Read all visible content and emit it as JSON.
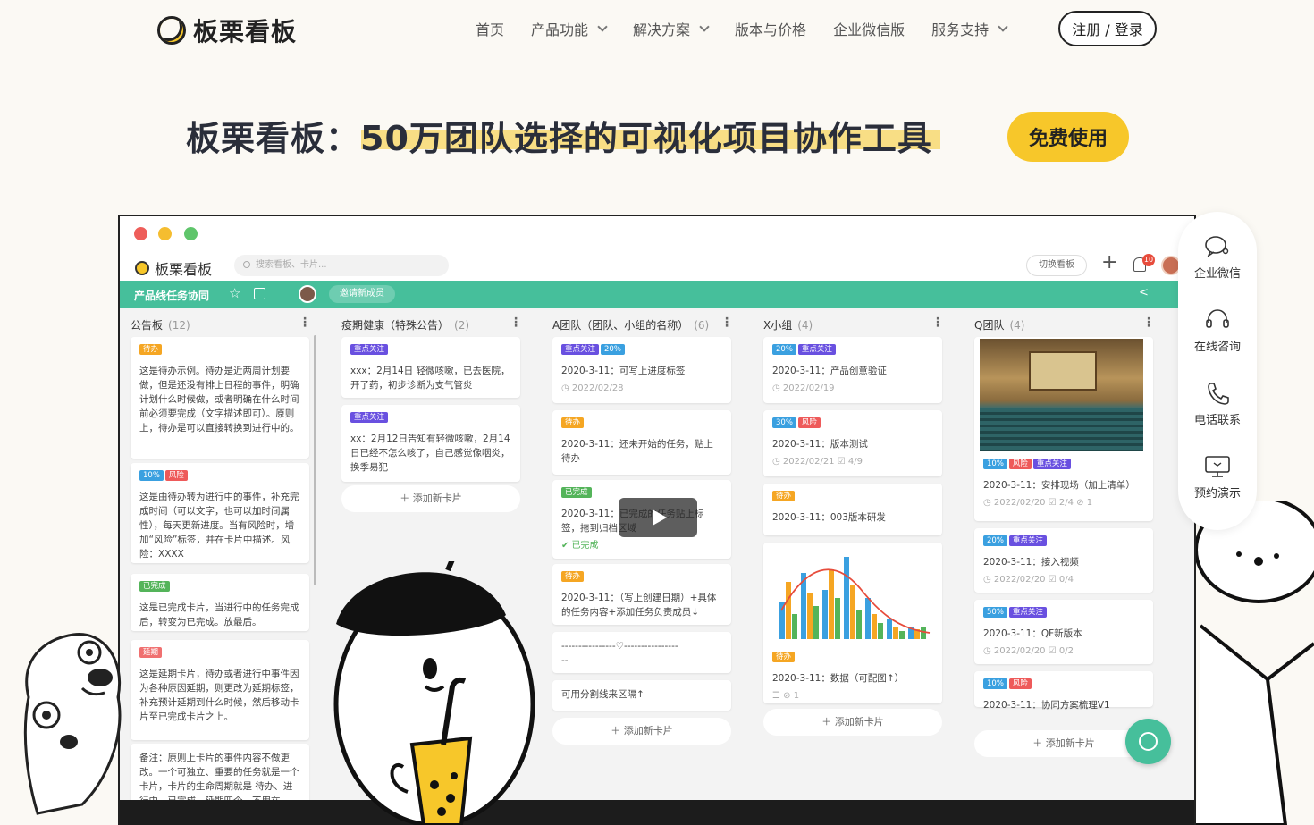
{
  "nav": {
    "logo_text": "板栗看板",
    "items": [
      {
        "label": "首页",
        "dropdown": false
      },
      {
        "label": "产品功能",
        "dropdown": true
      },
      {
        "label": "解决方案",
        "dropdown": true
      },
      {
        "label": "版本与价格",
        "dropdown": false
      },
      {
        "label": "企业微信版",
        "dropdown": false
      },
      {
        "label": "服务支持",
        "dropdown": true
      }
    ],
    "login_label": "注册 / 登录"
  },
  "hero": {
    "title": "板栗看板：50万团队选择的可视化项目协作工具",
    "cta_label": "免费使用"
  },
  "app": {
    "logo_text": "板栗看板",
    "search_placeholder": "搜索看板、卡片...",
    "switch_label": "切换看板",
    "notification_count": "10",
    "board_title": "产品线任务协同",
    "invite_label": "邀请新成员",
    "add_card_label": "＋ 添加新卡片"
  },
  "lists": [
    {
      "title": "公告板",
      "count": "(12)",
      "cards": [
        {
          "tags": [
            {
              "text": "待办",
              "type": "todo"
            }
          ],
          "text": "这是待办示例。待办是近两周计划要做，但是还没有排上日程的事件，明确计划什么时候做，或者明确在什么时间前必须要完成（文字描述即可）。原则上，待办是可以直接转换到进行中的。"
        },
        {
          "tags": [
            {
              "text": "10%",
              "type": "pct"
            },
            {
              "text": "风险",
              "type": "risk"
            }
          ],
          "text": "这是由待办转为进行中的事件，补充完成时间（可以文字，也可以加时间属性），每天更新进度。当有风险时，增加“风险”标签，并在卡片中描述。风险：XXXX"
        },
        {
          "tags": [
            {
              "text": "已完成",
              "type": "done"
            }
          ],
          "text": "这是已完成卡片，当进行中的任务完成后，转变为已完成。放最后。"
        },
        {
          "tags": [
            {
              "text": "延期",
              "type": "late"
            }
          ],
          "text": "这是延期卡片，待办或者进行中事件因为各种原因延期，则更改为延期标签，补充预计延期到什么时候，然后移动卡片至已完成卡片之上。"
        },
        {
          "tags": [],
          "text": "备注：原则上卡片的事件内容不做更改。一个可独立、重要的任务就是一个卡片，卡片的生命周期就是 待办、进行中、已完成、延期四个。不用在"
        }
      ]
    },
    {
      "title": "疫期健康（特殊公告）",
      "count": "(2)",
      "cards": [
        {
          "tags": [
            {
              "text": "重点关注",
              "type": "imp"
            }
          ],
          "text": "xxx：2月14日 轻微咳嗽，已去医院，开了药，初步诊断为支气管炎"
        },
        {
          "tags": [
            {
              "text": "重点关注",
              "type": "imp"
            }
          ],
          "text": "xx：2月12日告知有轻微咳嗽，2月14日已经不怎么咳了，自己感觉像咽炎，换季易犯"
        }
      ]
    },
    {
      "title": "A团队（团队、小组的名称）",
      "count": "(6)",
      "cards": [
        {
          "tags": [
            {
              "text": "重点关注",
              "type": "imp"
            },
            {
              "text": "20%",
              "type": "pct"
            }
          ],
          "text": "2020-3-11：可写上进度标签",
          "meta": "◷ 2022/02/28"
        },
        {
          "tags": [
            {
              "text": "待办",
              "type": "todo"
            }
          ],
          "text": "2020-3-11：还未开始的任务，贴上待办"
        },
        {
          "tags": [
            {
              "text": "已完成",
              "type": "done"
            }
          ],
          "text": "2020-3-11：已完成的任务贴上标签，拖到归档区域",
          "meta": "✔ 已完成"
        },
        {
          "tags": [
            {
              "text": "待办",
              "type": "todo"
            }
          ],
          "text": "2020-3-11：（写上创建日期）+具体的任务内容+添加任务负责成员↓"
        },
        {
          "tags": [],
          "text": "----------------♡----------------\n--"
        },
        {
          "tags": [],
          "text": "可用分割线来区隔↑"
        }
      ]
    },
    {
      "title": "X小组",
      "count": "(4)",
      "cards": [
        {
          "tags": [
            {
              "text": "20%",
              "type": "pct"
            },
            {
              "text": "重点关注",
              "type": "imp"
            }
          ],
          "text": "2020-3-11：产品创意验证",
          "meta": "◷ 2022/02/19"
        },
        {
          "tags": [
            {
              "text": "30%",
              "type": "pct"
            },
            {
              "text": "风险",
              "type": "risk"
            }
          ],
          "text": "2020-3-11：版本测试",
          "meta": "◷ 2022/02/21 ☑ 4/9"
        },
        {
          "tags": [
            {
              "text": "待办",
              "type": "todo"
            }
          ],
          "text": "2020-3-11：003版本研发"
        },
        {
          "tags": [
            {
              "text": "待办",
              "type": "todo"
            }
          ],
          "text": "2020-3-11：数据（可配图↑）",
          "meta": "☰ ⊘ 1"
        }
      ]
    },
    {
      "title": "Q团队",
      "count": "(4)",
      "cards": [
        {
          "tags": [
            {
              "text": "10%",
              "type": "pct"
            },
            {
              "text": "风险",
              "type": "risk"
            },
            {
              "text": "重点关注",
              "type": "imp"
            }
          ],
          "text": "2020-3-11：安排现场（加上清单）",
          "meta": "◷ 2022/02/20 ☑ 2/4 ⊘ 1"
        },
        {
          "tags": [
            {
              "text": "20%",
              "type": "pct"
            },
            {
              "text": "重点关注",
              "type": "imp"
            }
          ],
          "text": "2020-3-11：接入视频",
          "meta": "◷ 2022/02/20 ☑ 0/4"
        },
        {
          "tags": [
            {
              "text": "50%",
              "type": "pct"
            },
            {
              "text": "重点关注",
              "type": "imp"
            }
          ],
          "text": "2020-3-11：QF新版本",
          "meta": "◷ 2022/02/20 ☑ 0/2"
        },
        {
          "tags": [
            {
              "text": "10%",
              "type": "pct"
            },
            {
              "text": "风险",
              "type": "risk"
            }
          ],
          "text": "2020-3-11：协同方案梳理V1"
        }
      ]
    }
  ],
  "side_panel": [
    {
      "label": "企业微信",
      "icon": "wechat-icon"
    },
    {
      "label": "在线咨询",
      "icon": "headset-icon"
    },
    {
      "label": "电话联系",
      "icon": "phone-icon"
    },
    {
      "label": "预约演示",
      "icon": "monitor-icon"
    }
  ],
  "colors": {
    "accent_yellow": "#f7c72a",
    "board_green": "#46bf9b",
    "tag_todo": "#f5a623",
    "tag_important": "#6950e0",
    "tag_percent": "#3aa0e0",
    "tag_risk": "#ee5a5a",
    "tag_done": "#54b45a"
  }
}
